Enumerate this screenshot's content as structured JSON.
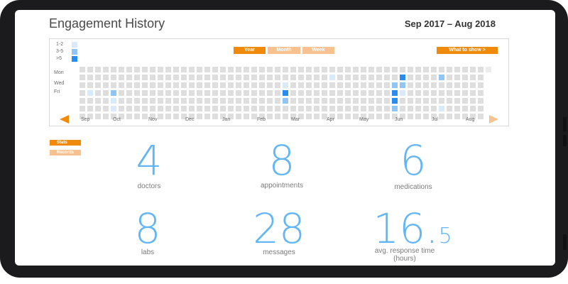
{
  "header": {
    "title": "Engagement History",
    "date_range": "Sep 2017 – Aug 2018"
  },
  "legend": [
    {
      "label": "1-2",
      "color": "#d9ebfb"
    },
    {
      "label": "3-5",
      "color": "#8fc6f6"
    },
    {
      "label": ">5",
      "color": "#2a8bf0"
    }
  ],
  "view_tabs": [
    {
      "label": "Year",
      "state": "selected"
    },
    {
      "label": "Month",
      "state": "unselected"
    },
    {
      "label": "Week",
      "state": "unselected"
    }
  ],
  "what_to_show_label": "What to show >",
  "days": [
    "Mon",
    "Wed",
    "Fri"
  ],
  "months": [
    "Sep",
    "Oct",
    "Nov",
    "Dec",
    "Jan",
    "Feb",
    "Mar",
    "Apr",
    "May",
    "Jun",
    "Jul",
    "Aug"
  ],
  "heatmap": {
    "weeks": 53,
    "days_per_week": 7,
    "active_cells": [
      {
        "week": 1,
        "day": 3,
        "level": 1
      },
      {
        "week": 4,
        "day": 3,
        "level": 2
      },
      {
        "week": 4,
        "day": 4,
        "level": 1
      },
      {
        "week": 4,
        "day": 5,
        "level": 1
      },
      {
        "week": 26,
        "day": 2,
        "level": 1
      },
      {
        "week": 26,
        "day": 3,
        "level": 3
      },
      {
        "week": 26,
        "day": 4,
        "level": 2
      },
      {
        "week": 32,
        "day": 1,
        "level": 1
      },
      {
        "week": 40,
        "day": 2,
        "level": 2
      },
      {
        "week": 40,
        "day": 3,
        "level": 3
      },
      {
        "week": 40,
        "day": 4,
        "level": 3
      },
      {
        "week": 40,
        "day": 5,
        "level": 2
      },
      {
        "week": 41,
        "day": 1,
        "level": 3
      },
      {
        "week": 41,
        "day": 2,
        "level": 2
      },
      {
        "week": 41,
        "day": 3,
        "level": 1
      },
      {
        "week": 46,
        "day": 1,
        "level": 2
      },
      {
        "week": 46,
        "day": 5,
        "level": 1
      }
    ],
    "empty_color": "#dedede",
    "future_color": "#ececec"
  },
  "nav": {
    "prev_color": "#f08a0c",
    "next_color": "#f8c290"
  },
  "side_tabs": [
    {
      "label": "Stats",
      "state": "selected"
    },
    {
      "label": "Records",
      "state": "unselected"
    }
  ],
  "stats": [
    {
      "value": "4",
      "label": "doctors"
    },
    {
      "value": "8",
      "label": "appointments"
    },
    {
      "value": "6",
      "label": "medications"
    },
    {
      "value": "8",
      "label": "labs"
    },
    {
      "value": "28",
      "label": "messages"
    },
    {
      "value": "16.",
      "value_suffix": "5",
      "label": "avg. response time",
      "label_line2": "(hours)"
    }
  ],
  "colors": {
    "accent": "#f08a0c",
    "accent_light": "#f8c290",
    "stat_blue": "#63b6f5"
  }
}
